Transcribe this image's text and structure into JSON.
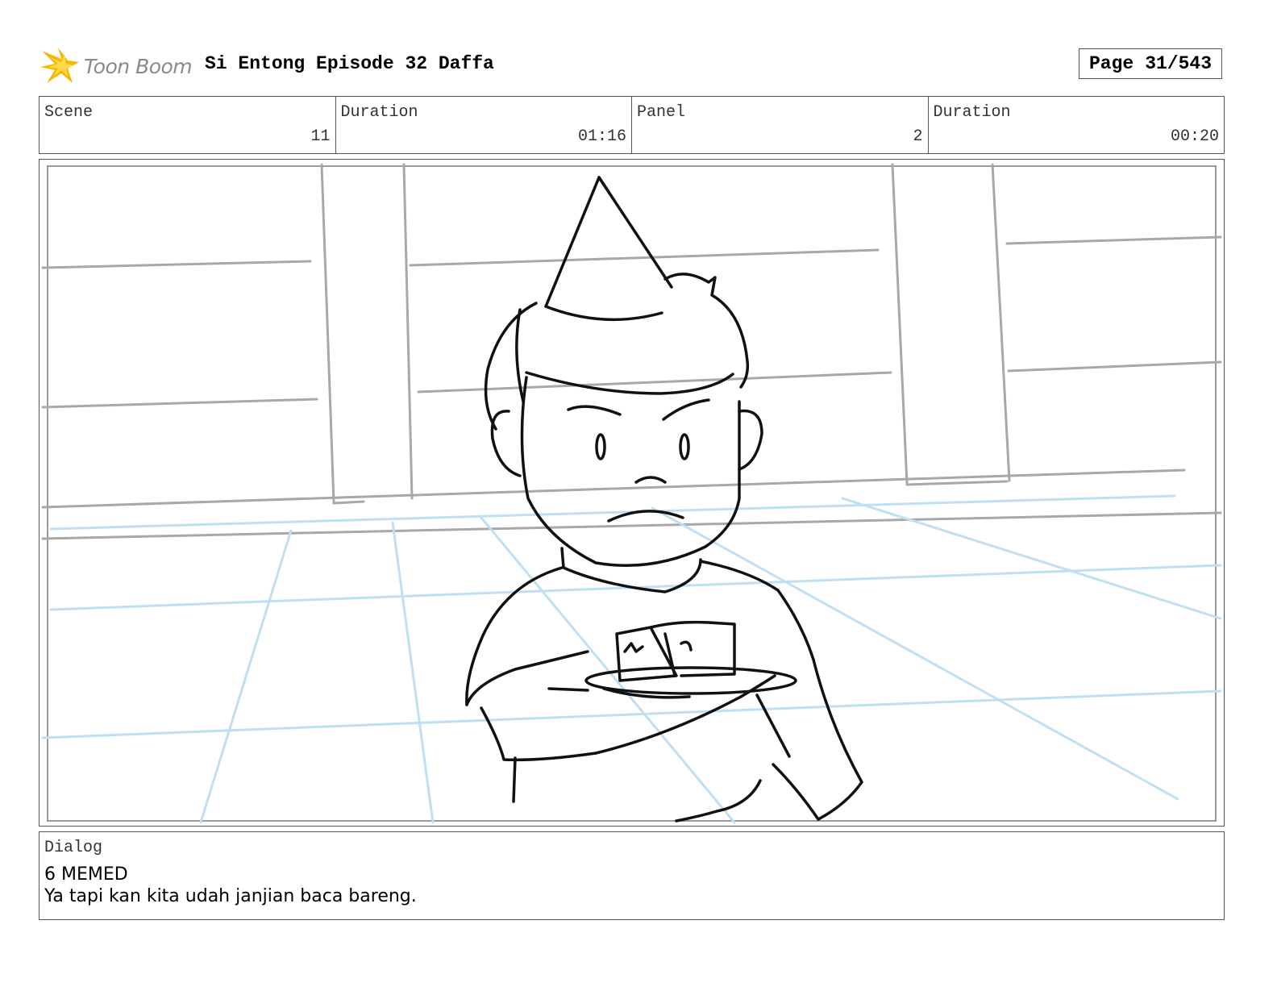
{
  "header": {
    "logo_text": "Toon Boom",
    "title": "Si Entong Episode 32 Daffa",
    "page_label": "Page",
    "page_value": "31/543"
  },
  "info": {
    "scene_label": "Scene",
    "scene_value": "11",
    "scene_duration_label": "Duration",
    "scene_duration_value": "01:16",
    "panel_label": "Panel",
    "panel_value": "2",
    "panel_duration_label": "Duration",
    "panel_duration_value": "00:20"
  },
  "dialog": {
    "label": "Dialog",
    "speaker": "6 MEMED",
    "line": "Ya tapi kan kita udah janjian baca bareng."
  },
  "colors": {
    "logo_star": "#f5b800",
    "grid_gray": "#a8a8a8",
    "floor_blue": "#bfe0f2",
    "ink": "#111111"
  }
}
